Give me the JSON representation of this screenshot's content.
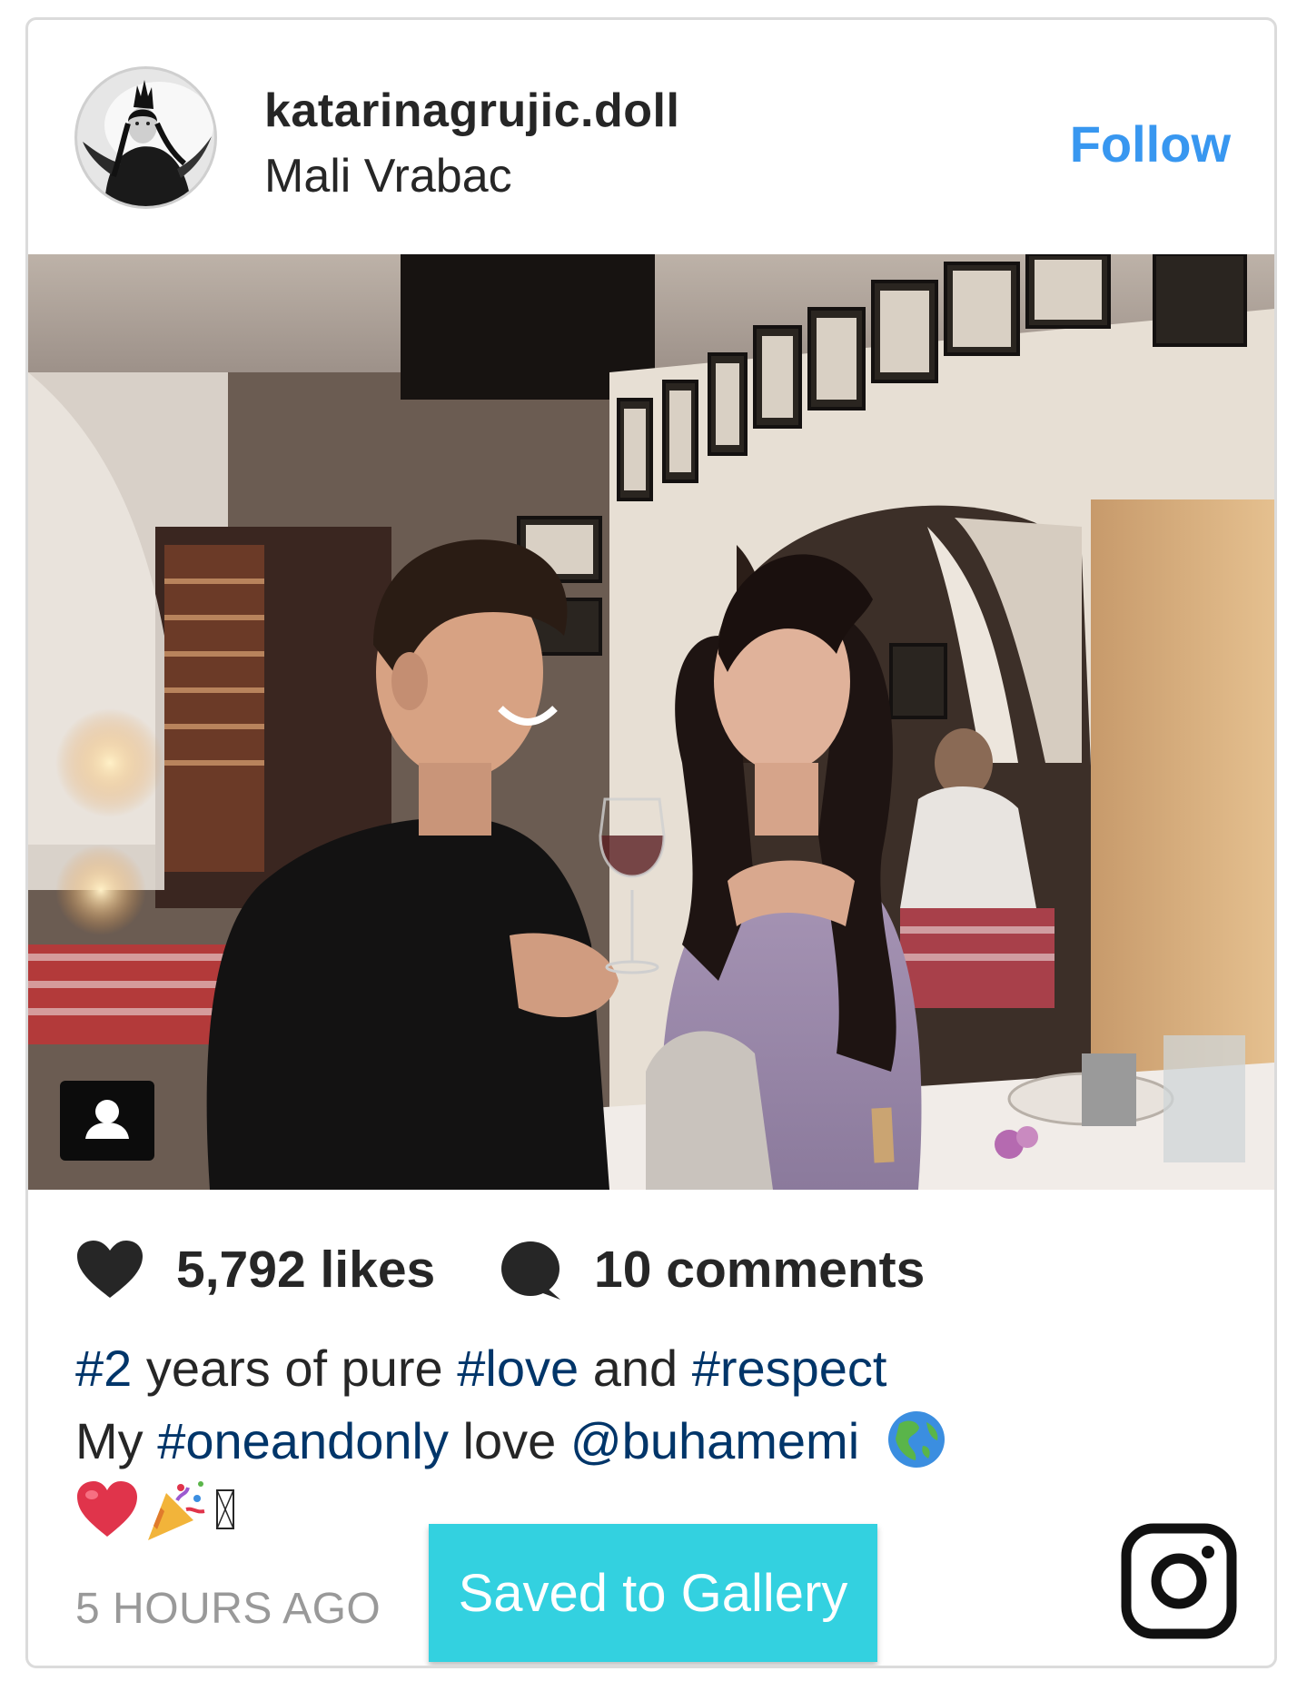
{
  "post": {
    "username": "katarinagrujic.doll",
    "location": "Mali Vrabac",
    "follow_label": "Follow",
    "likes_label": "5,792 likes",
    "comments_label": "10 comments",
    "caption_line1": [
      {
        "text": "#2",
        "tag": true
      },
      {
        "text": " years of pure ",
        "tag": false
      },
      {
        "text": "#love",
        "tag": true
      },
      {
        "text": " and ",
        "tag": false
      },
      {
        "text": "#respect",
        "tag": true
      }
    ],
    "caption_line2": [
      {
        "text": "My ",
        "tag": false
      },
      {
        "text": "#oneandonly",
        "tag": true
      },
      {
        "text": " love ",
        "tag": false
      },
      {
        "text": "@buhamemi",
        "tag": true
      }
    ],
    "caption_emojis": [
      "globe-americas-icon",
      "red-heart-icon",
      "party-popper-icon",
      "missing-glyph-box"
    ],
    "time_label": "5 HOURS AGO",
    "saved_label": "Saved to Gallery"
  },
  "icons": {
    "heart": "heart-icon",
    "comment": "comment-icon",
    "tag": "user-tag-icon",
    "instagram": "instagram-logo-icon"
  },
  "colors": {
    "follow_blue": "#3897f0",
    "hashtag_navy": "#003569",
    "saved_button_cyan": "#33d1e0",
    "timestamp_gray": "#999999",
    "text_dark": "#262626"
  }
}
